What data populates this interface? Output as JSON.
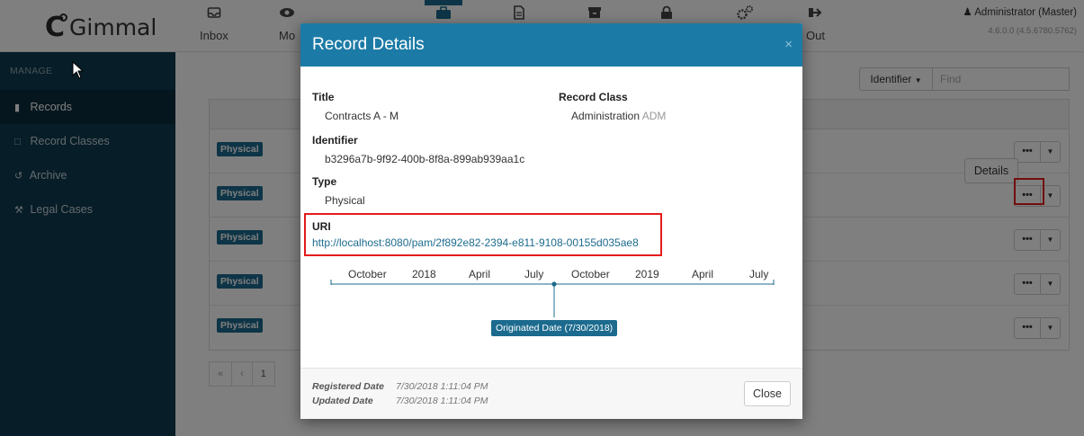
{
  "app": {
    "logo_text": "Gimmal",
    "nav": [
      {
        "label": "Inbox",
        "icon": "inbox-icon"
      },
      {
        "label": "Mo",
        "icon": "eye-icon"
      },
      {
        "label": "",
        "icon": "briefcase-icon"
      },
      {
        "label": "",
        "icon": "document-icon"
      },
      {
        "label": "",
        "icon": "archive-box-icon"
      },
      {
        "label": "",
        "icon": "lock-icon"
      },
      {
        "label": "",
        "icon": "gears-icon"
      },
      {
        "label": "Out",
        "icon": "sign-out-icon"
      }
    ],
    "user": "Administrator (Master)",
    "version": "4.6.0.0 (4.5.6780.5762)"
  },
  "sidebar": {
    "section": "MANAGE",
    "items": [
      {
        "label": "Records",
        "icon": "file-icon",
        "active": true
      },
      {
        "label": "Record Classes",
        "icon": "folder-icon"
      },
      {
        "label": "Archive",
        "icon": "history-icon"
      },
      {
        "label": "Legal Cases",
        "icon": "gavel-icon"
      }
    ]
  },
  "main": {
    "filter_label": "Identifier",
    "find_placeholder": "Find",
    "rows": [
      {
        "type": "Physical"
      },
      {
        "type": "Physical"
      },
      {
        "type": "Physical"
      },
      {
        "type": "Physical"
      },
      {
        "type": "Physical"
      }
    ],
    "row_action_label": "•••",
    "tooltip": "Details",
    "pager": [
      "«",
      "‹",
      "1"
    ]
  },
  "modal": {
    "title": "Record Details",
    "close_x": "×",
    "fields": {
      "title_label": "Title",
      "title_value": "Contracts A - M",
      "record_class_label": "Record Class",
      "record_class_value": "Administration",
      "record_class_code": "ADM",
      "identifier_label": "Identifier",
      "identifier_value": "b3296a7b-9f92-400b-8f8a-899ab939aa1c",
      "type_label": "Type",
      "type_value": "Physical",
      "uri_label": "URI",
      "uri_value": "http://localhost:8080/pam/2f892e82-2394-e811-9108-00155d035ae8"
    },
    "timeline": {
      "ticks": [
        "October",
        "2018",
        "April",
        "July",
        "October",
        "2019",
        "April",
        "July"
      ],
      "event_label": "Originated Date (7/30/2018)"
    },
    "footer": {
      "registered_label": "Registered Date",
      "registered_value": "7/30/2018 1:11:04 PM",
      "updated_label": "Updated Date",
      "updated_value": "7/30/2018 1:11:04 PM",
      "close_label": "Close"
    }
  },
  "colors": {
    "brand": "#1c7ba6",
    "sidebar": "#0e3a4e",
    "highlight": "#e41c1c"
  }
}
